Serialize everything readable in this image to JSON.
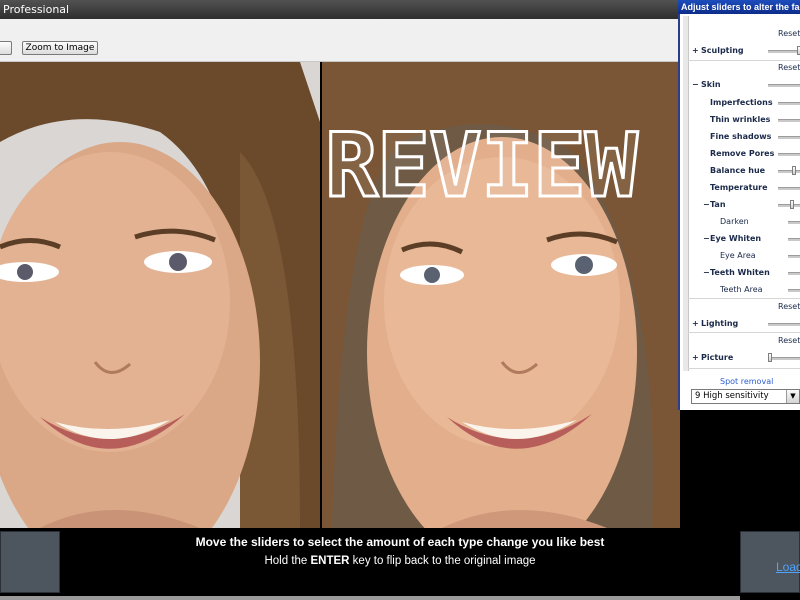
{
  "window": {
    "title": "Professional"
  },
  "toolbar": {
    "zoom_label": "Zoom to Image"
  },
  "watermark": "REVIEW",
  "instructions": {
    "line1": "Move the sliders to select the amount of each type change you like best",
    "line2_pre": "Hold the ",
    "line2_key": "ENTER",
    "line2_post": " key to flip back to the original image"
  },
  "load_link": "Load",
  "panel": {
    "title": "Adjust sliders to alter the face",
    "reset_label": "Reset",
    "sculpting": "Sculpting",
    "skin": "Skin",
    "skin_items": [
      "Imperfections",
      "Thin wrinkles",
      "Fine shadows",
      "Remove Pores",
      "Balance hue",
      "Temperature"
    ],
    "tan": "Tan",
    "darken": "Darken",
    "eye_whiten": "Eye Whiten",
    "eye_area": "Eye Area",
    "teeth_whiten": "Teeth Whiten",
    "teeth_area": "Teeth Area",
    "lighting": "Lighting",
    "picture": "Picture",
    "spot_removal": "Spot removal",
    "sensitivity_value": "9 High sensitivity",
    "expand_symbol": "+",
    "collapse_symbol": "−"
  },
  "colors": {
    "panel_title_bg": "#1d4dbd",
    "link": "#4fa3ff",
    "spot_removal": "#2f5fd0"
  }
}
